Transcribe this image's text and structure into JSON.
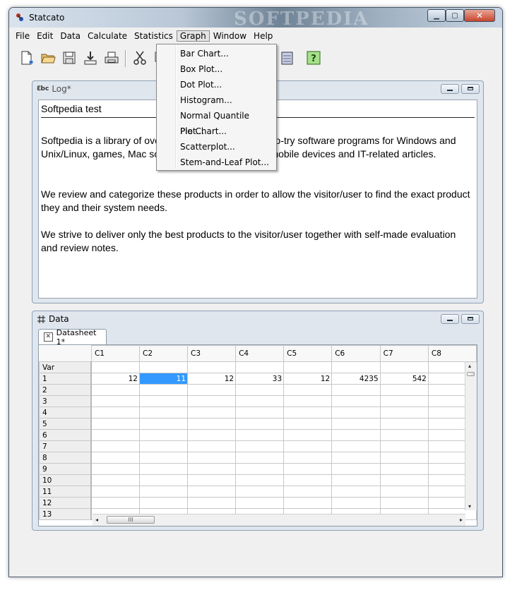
{
  "window": {
    "title": "Statcato",
    "watermark": "SOFTPEDIA",
    "min_glyph": "▁",
    "max_glyph": "▢",
    "close_glyph": "✕"
  },
  "menubar": [
    "File",
    "Edit",
    "Data",
    "Calculate",
    "Statistics",
    "Graph",
    "Window",
    "Help"
  ],
  "toolbar": {
    "icons": [
      "new-icon",
      "open-folder-icon",
      "save-icon",
      "import-icon",
      "print-icon",
      "cut-icon",
      "copy-icon",
      "help-icon"
    ],
    "help_glyph": "?"
  },
  "graph_menu": {
    "items": [
      "Bar Chart...",
      "Box Plot...",
      "Dot Plot...",
      "Histogram...",
      "Normal Quantile Plot...",
      "Pie Chart...",
      "Scatterplot...",
      "Stem-and-Leaf Plot..."
    ]
  },
  "log": {
    "icon_text": "ℇbc",
    "title": "Log*",
    "heading": "Softpedia test",
    "paragraphs": [
      "Softpedia is a library of over 1,300,000 free and free-to-try software programs for Windows and Unix/Linux, games, Mac software, Windows drivers, mobile devices and IT-related articles.",
      "We review and categorize these products in order to allow the visitor/user to find the exact product they and their system needs.",
      "We strive to deliver only the best products to the visitor/user together with self-made evaluation and review notes."
    ]
  },
  "data": {
    "title": "Data",
    "tab_label": "Datasheet 1*",
    "tab_close_glyph": "✕",
    "columns": [
      "C1",
      "C2",
      "C3",
      "C4",
      "C5",
      "C6",
      "C7",
      "C8"
    ],
    "var_label": "Var",
    "row_numbers": [
      "1",
      "2",
      "3",
      "4",
      "5",
      "6",
      "7",
      "8",
      "9",
      "10",
      "11",
      "12",
      "13"
    ],
    "row1_values": [
      "12",
      "11",
      "12",
      "33",
      "12",
      "4235",
      "542",
      ""
    ],
    "selected_cell": "C2 row 1",
    "hthumb_glyph": "III",
    "arrows": {
      "left": "◂",
      "right": "▸",
      "up": "▴",
      "down": "▾"
    }
  }
}
